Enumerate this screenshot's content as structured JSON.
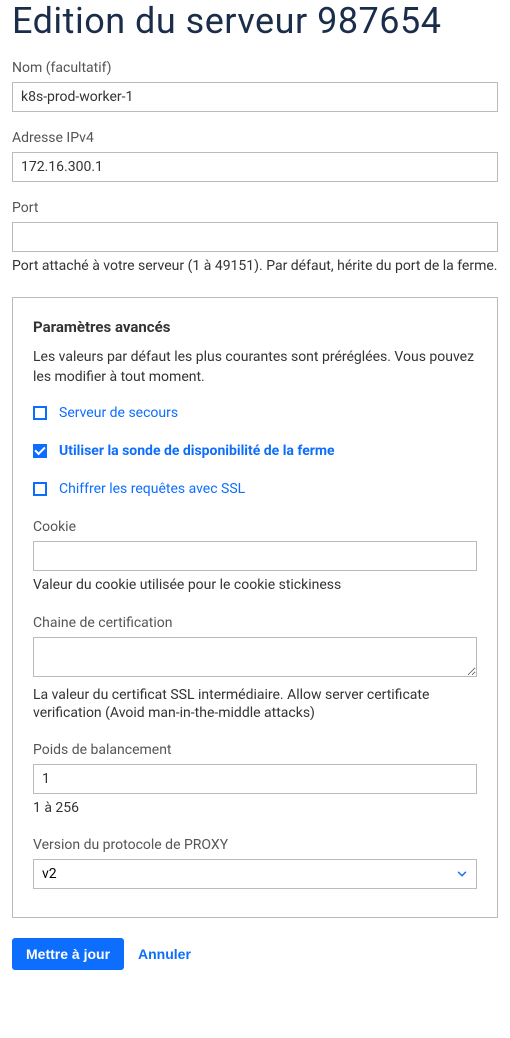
{
  "title": "Edition du serveur 987654",
  "fields": {
    "name": {
      "label": "Nom (facultatif)",
      "value": "k8s-prod-worker-1"
    },
    "ipv4": {
      "label": "Adresse IPv4",
      "value": "172.16.300.1"
    },
    "port": {
      "label": "Port",
      "value": "",
      "helper": "Port attaché à votre serveur (1 à 49151). Par défaut, hérite du port de la ferme."
    }
  },
  "advanced": {
    "title": "Paramètres avancés",
    "description": "Les valeurs par défaut les plus courantes sont préréglées. Vous pouvez les modifier à tout moment.",
    "checkboxes": {
      "backup": {
        "label": "Serveur de secours",
        "checked": false
      },
      "probe": {
        "label": "Utiliser la sonde de disponibilité de la ferme",
        "checked": true
      },
      "ssl": {
        "label": "Chiffrer les requêtes avec SSL",
        "checked": false
      }
    },
    "cookie": {
      "label": "Cookie",
      "value": "",
      "helper": "Valeur du cookie utilisée pour le cookie stickiness"
    },
    "cert_chain": {
      "label": "Chaine de certification",
      "value": "",
      "helper": "La valeur du certificat SSL intermédiaire. Allow server certificate verification (Avoid man-in-the-middle attacks)"
    },
    "weight": {
      "label": "Poids de balancement",
      "value": "1",
      "helper": "1 à 256"
    },
    "proxy_version": {
      "label": "Version du protocole de PROXY",
      "value": "v2"
    }
  },
  "actions": {
    "submit": "Mettre à jour",
    "cancel": "Annuler"
  }
}
